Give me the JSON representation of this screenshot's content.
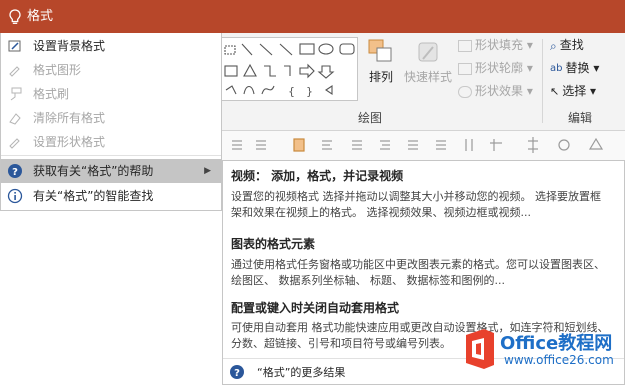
{
  "search": {
    "query": "格式"
  },
  "ribbon": {
    "drawing_group_label": "绘图",
    "arrange_label": "排列",
    "quick_styles_label": "快速样式",
    "shape_fill_label": "形状填充",
    "shape_outline_label": "形状轮廓",
    "shape_effects_label": "形状效果",
    "find_label": "查找",
    "replace_label": "替换",
    "select_label": "选择",
    "editing_group_label": "编辑"
  },
  "menu": {
    "items": [
      {
        "label": "设置背景格式",
        "enabled": true
      },
      {
        "label": "格式图形",
        "enabled": false
      },
      {
        "label": "格式刷",
        "enabled": false
      },
      {
        "label": "清除所有格式",
        "enabled": false
      },
      {
        "label": "设置形状格式",
        "enabled": false
      },
      {
        "label": "获取有关“格式”的帮助",
        "enabled": true,
        "selected": true
      },
      {
        "label": "有关“格式”的智能查找",
        "enabled": true
      }
    ]
  },
  "help": {
    "results": [
      {
        "title": "视频：  添加，格式，并记录视频",
        "desc": "设置您的视频格式 选择并拖动以调整其大小并移动您的视频。 选择要放置框架和效果在视频上的格式。 选择视频效果、视频边框或视频..."
      },
      {
        "title": "图表的格式元素",
        "desc": "通过使用格式任务窗格或功能区中更改图表元素的格式。您可以设置图表区、 绘图区、 数据系列坐标轴、 标题、 数据标签和图例的..."
      },
      {
        "title": "配置或键入时关闭自动套用格式",
        "desc": "可使用自动套用 格式功能快速应用或更改自动设置格式，如连字符和短划线、分数、超链接、引号和项目符号或编号列表。"
      }
    ],
    "more_results": "“格式”的更多结果"
  },
  "watermark": {
    "brand": "Office教程网",
    "url": "www.office26.com"
  },
  "colors": {
    "accent": "#b7472a",
    "selected_bg": "#c5c5c5",
    "help_icon": "#2b579a",
    "watermark": "#1e6fc7"
  }
}
